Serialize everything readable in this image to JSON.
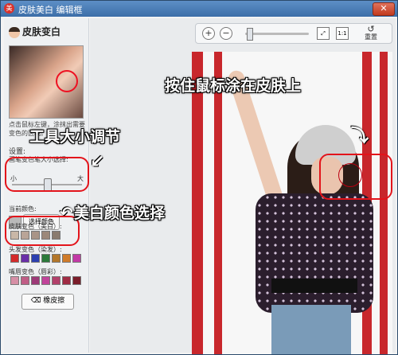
{
  "window": {
    "title": "皮肤美白 编辑框",
    "app_icon": "app-logo-icon",
    "close_label": "✕"
  },
  "sidebar": {
    "heading": "皮肤变白",
    "hint": "点击鼠标左键，涂抹出需要变色的区域。",
    "settings_label": "设置:",
    "brush_label": "画笔变色笔大小选择:",
    "slider_min": "小",
    "slider_max": "大",
    "slider_value": 0.5,
    "current_color_label": "当前颜色:",
    "pick_color_button": "选择颜色",
    "skin_label": "皮肤变色（美白）:",
    "skin_colors": [
      "#c9b7a7",
      "#b9a497",
      "#a99487",
      "#9c887a",
      "#8a7b6e"
    ],
    "hair_label": "头发变色（染发）:",
    "hair_colors": [
      "#d32a2a",
      "#6a2fa8",
      "#2c3fb0",
      "#2b7a3a",
      "#b3762a",
      "#d07b2a",
      "#c23aa6"
    ],
    "lip_label": "嘴唇变色（唇彩）:",
    "lip_colors": [
      "#d68fa6",
      "#c05d86",
      "#9d3a78",
      "#c1449a",
      "#b2406a",
      "#a02c44",
      "#7a1d2a"
    ],
    "eraser_button": "橡皮擦"
  },
  "toolbar": {
    "zoom_in_icon": "zoom-in-icon",
    "zoom_out_icon": "zoom-out-icon",
    "zoom_level": 0.1,
    "fit_label": "⤢",
    "actual_label": "1:1",
    "reset_label": "重置"
  },
  "annotations": {
    "paint_skin": "按住鼠标涂在皮肤上",
    "brush_size": "工具大小调节",
    "whitening_color": "美白颜色选择"
  },
  "colors": {
    "title_bar": "#3c6ea8",
    "highlight": "#e3141b",
    "wall_red": "#c8272c"
  }
}
